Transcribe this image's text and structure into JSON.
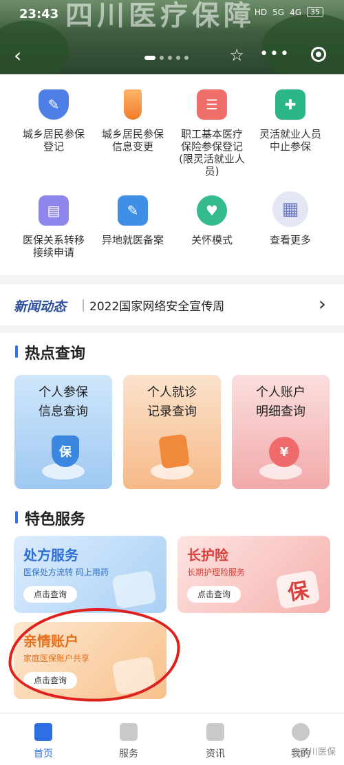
{
  "status_bar": {
    "time": "23:43",
    "network": "HD",
    "signal": "5G",
    "signal2": "4G",
    "battery": "35"
  },
  "header": {
    "banner_text": "四川医疗保障"
  },
  "services": [
    {
      "label": "城乡居民参保登记",
      "icon": "shield-pen-icon"
    },
    {
      "label": "城乡居民参保信息变更",
      "icon": "tie-icon"
    },
    {
      "label": "职工基本医疗保险参保登记(限灵活就业人员)",
      "icon": "id-card-icon"
    },
    {
      "label": "灵活就业人员中止参保",
      "icon": "medical-kit-icon"
    },
    {
      "label": "医保关系转移接续申请",
      "icon": "printer-icon"
    },
    {
      "label": "异地就医备案",
      "icon": "document-pen-icon"
    },
    {
      "label": "关怀模式",
      "icon": "heart-person-icon"
    },
    {
      "label": "查看更多",
      "icon": "grid-more-icon"
    }
  ],
  "news": {
    "tag": "新闻动态",
    "title": "2022国家网络安全宣传周"
  },
  "hot": {
    "title": "热点查询",
    "cards": [
      {
        "line1": "个人参保",
        "line2": "信息查询",
        "glyph": "保"
      },
      {
        "line1": "个人就诊",
        "line2": "记录查询",
        "glyph": ""
      },
      {
        "line1": "个人账户",
        "line2": "明细查询",
        "glyph": "¥"
      }
    ]
  },
  "special": {
    "title": "特色服务",
    "cards": [
      {
        "title": "处方服务",
        "subtitle": "医保处方流转 码上用药",
        "button": "点击查询"
      },
      {
        "title": "长护险",
        "subtitle": "长期护理险服务",
        "button": "点击查询",
        "glyph": "保"
      },
      {
        "title": "亲情账户",
        "subtitle": "家庭医保账户共享",
        "button": "点击查询"
      }
    ]
  },
  "tabbar": [
    {
      "label": "首页",
      "active": true
    },
    {
      "label": "服务"
    },
    {
      "label": "资讯"
    },
    {
      "label": "我的"
    }
  ],
  "watermark": "@四川医保"
}
